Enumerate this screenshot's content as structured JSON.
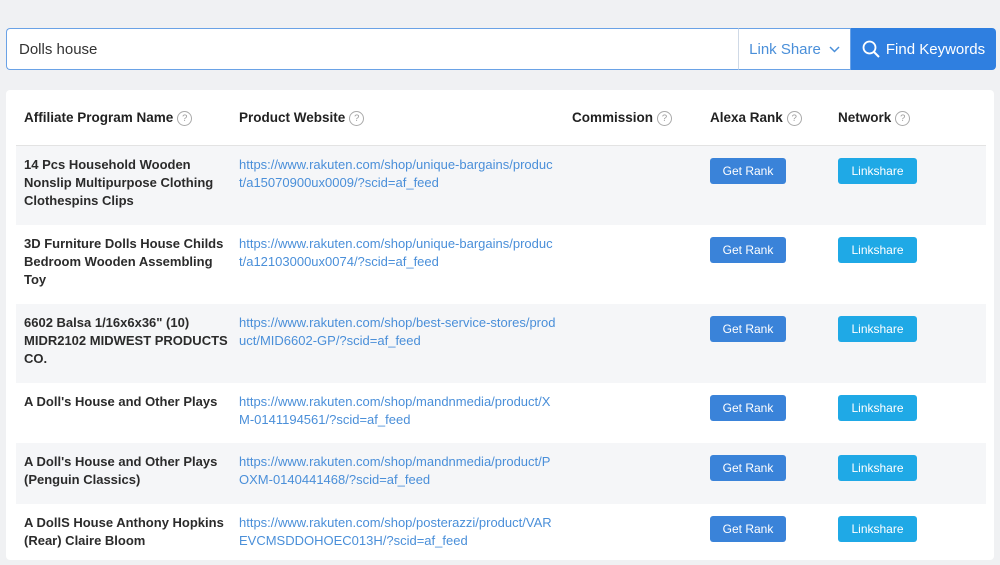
{
  "search": {
    "query": "Dolls house",
    "network_selected": "Link Share",
    "find_button_label": "Find Keywords",
    "accent_color": "#2f7fe0"
  },
  "table": {
    "headers": {
      "name": "Affiliate Program Name",
      "website": "Product Website",
      "commission": "Commission",
      "alexa": "Alexa Rank",
      "network": "Network"
    },
    "help_glyph": "?",
    "rows": [
      {
        "name": "14 Pcs Household Wooden Nonslip Multipurpose Clothing Clothespins Clips",
        "url": "https://www.rakuten.com/shop/unique-bargains/product/a15070900ux0009/?scid=af_feed",
        "commission": "",
        "rank_button": "Get Rank",
        "network_button": "Linkshare"
      },
      {
        "name": "3D Furniture Dolls House Childs Bedroom Wooden Assembling Toy",
        "url": "https://www.rakuten.com/shop/unique-bargains/product/a12103000ux0074/?scid=af_feed",
        "commission": "",
        "rank_button": "Get Rank",
        "network_button": "Linkshare"
      },
      {
        "name": "6602 Balsa 1/16x6x36\" (10) MIDR2102 MIDWEST PRODUCTS CO.",
        "url": "https://www.rakuten.com/shop/best-service-stores/product/MID6602-GP/?scid=af_feed",
        "commission": "",
        "rank_button": "Get Rank",
        "network_button": "Linkshare"
      },
      {
        "name": "A Doll's House and Other Plays",
        "url": "https://www.rakuten.com/shop/mandnmedia/product/XM-0141194561/?scid=af_feed",
        "commission": "",
        "rank_button": "Get Rank",
        "network_button": "Linkshare"
      },
      {
        "name": "A Doll's House and Other Plays (Penguin Classics)",
        "url": "https://www.rakuten.com/shop/mandnmedia/product/POXM-0140441468/?scid=af_feed",
        "commission": "",
        "rank_button": "Get Rank",
        "network_button": "Linkshare"
      },
      {
        "name": "A DollS House Anthony Hopkins (Rear) Claire Bloom",
        "url": "https://www.rakuten.com/shop/posterazzi/product/VAREVCMSDDOHOEC013H/?scid=af_feed",
        "commission": "",
        "rank_button": "Get Rank",
        "network_button": "Linkshare"
      }
    ]
  }
}
